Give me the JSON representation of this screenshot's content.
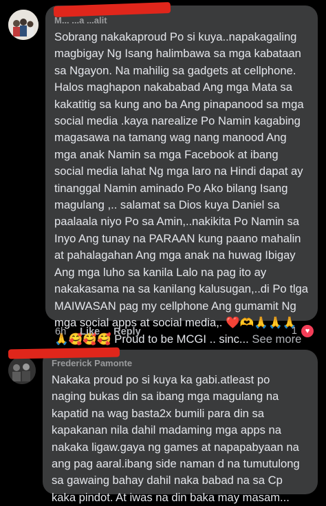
{
  "comment1": {
    "author": "M... ...a ...alit",
    "text": "Sobrang nakakaproud Po si kuya..napakagaling\nmagbigay Ng Isang halimbawa sa mga kabataan\nsa Ngayon. Na mahilig sa gadgets at cellphone.\nHalos maghapon nakababad Ang mga Mata sa\nkakatitig sa kung ano ba Ang pinapanood sa mga\nsocial media .kaya narealize Po Namin kagabing\nmagasawa na tamang wag nang manood Ang\nmga anak Namin sa mga Facebook at ibang\nsocial media lahat Ng mga laro na Hindi dapat ay\ntinanggal Namin aminado Po Ako bilang Isang\nmagulang ,.. salamat sa Dios kuya Daniel sa\npaalaala niyo Po sa Amin,..nakikita Po Namin sa\nInyo Ang tunay na PARAAN kung paano mahalin\nat pahalagahan Ang mga anak na huwag Ibigay\nAng mga luho sa kanila Lalo na pag ito ay\nnakakasama na sa kanilang kalusugan,..di Po tlga\nMAIWASAN pag my cellphone Ang gumamit Ng\nmga social apps at social media,. ❤️🫶🙏🙏🙏",
    "last_line": "🙏🥰🥰🥰 Proud to be MCGI .. sinc...",
    "see_more": "See more",
    "time": "6h",
    "like": "Like",
    "reply": "Reply",
    "reaction_count": "1"
  },
  "comment2": {
    "author": "Frederick Pamonte",
    "text": "Nakaka proud po si kuya ka gabi.atleast po\nnaging bukas din sa ibang mga magulang na\nkapatid na wag  basta2x bumili para din sa\nkapakanan nila dahil madaming mga apps na\nnakaka ligaw.gaya ng games at napapabyaan na\nang pag aaral.ibang side naman d na tumutulong\nsa gawaing bahay dahil naka babad na sa Cp\nkaka pindot. At iwas na din baka may masam..."
  },
  "colors": {
    "background": "#000000",
    "bubble": "#3a3b3c",
    "text": "#e4e6eb",
    "muted": "#b0b3b8",
    "redaction": "#e0261b",
    "heart": "#f33e58"
  }
}
